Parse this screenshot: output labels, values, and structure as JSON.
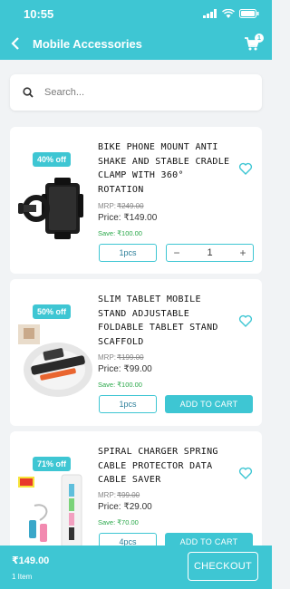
{
  "status_bar": {
    "time": "10:55"
  },
  "header": {
    "title": "Mobile Accessories",
    "cart_count": "1"
  },
  "search": {
    "placeholder": "Search..."
  },
  "products": [
    {
      "discount": "40% off",
      "name": "BIKE PHONE MOUNT ANTI SHAKE AND STABLE CRADLE CLAMP WITH 360° ROTATION",
      "mrp_label": "MRP:",
      "mrp": "₹249.00",
      "price": "Price: ₹149.00",
      "save": "Save: ₹100.00",
      "unit": "1pcs",
      "qty_minus": "−",
      "qty": "1",
      "qty_plus": "+"
    },
    {
      "discount": "50% off",
      "name": "SLIM TABLET MOBILE STAND ADJUSTABLE FOLDABLE TABLET STAND SCAFFOLD",
      "mrp_label": "MRP:",
      "mrp": "₹199.00",
      "price": "Price: ₹99.00",
      "save": "Save: ₹100.00",
      "unit": "1pcs",
      "action": "ADD TO CART"
    },
    {
      "discount": "71% off",
      "name": "SPIRAL CHARGER SPRING CABLE PROTECTOR DATA CABLE SAVER",
      "mrp_label": "MRP:",
      "mrp": "₹99.00",
      "price": "Price: ₹29.00",
      "save": "Save: ₹70.00",
      "unit": "4pcs",
      "action": "ADD TO CART"
    }
  ],
  "footer": {
    "total": "₹149.00",
    "items": "1 Item",
    "checkout": "CHECKOUT"
  },
  "colors": {
    "accent": "#3ec6d3",
    "save_green": "#2aa84a"
  },
  "icons": [
    "back-arrow-icon",
    "cart-icon",
    "search-icon",
    "heart-icon",
    "signal-icon",
    "wifi-icon",
    "battery-icon"
  ]
}
